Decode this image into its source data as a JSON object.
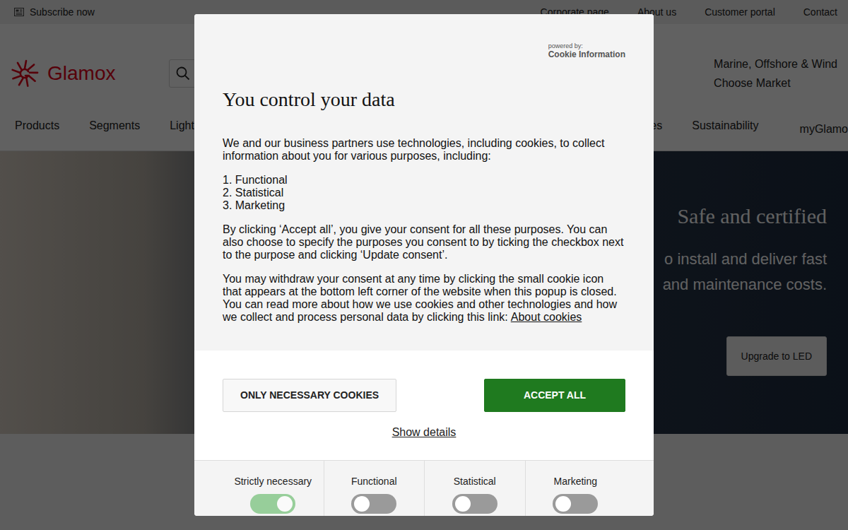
{
  "top_bar": {
    "subscribe": "Subscribe now",
    "links": [
      "Corporate page",
      "About us",
      "Customer portal",
      "Contact"
    ]
  },
  "header": {
    "logo": "Glamox",
    "market": "Marine, Offshore & Wind",
    "choose_market": "Choose Market"
  },
  "nav": {
    "left": [
      "Products",
      "Segments",
      "Light"
    ],
    "right": [
      "es",
      "Sustainability",
      "myGlamo"
    ]
  },
  "hero": {
    "title": "Safe and certified",
    "lines": [
      "o install and deliver fast",
      "and maintenance costs."
    ],
    "button": "Upgrade to LED"
  },
  "cookie_dialog": {
    "powered_by": "powered by:",
    "provider": "Cookie Information",
    "title": "You control your data",
    "intro": "We and our business partners use technologies, including cookies, to collect information about you for various purposes, including:",
    "purposes": [
      "1. Functional",
      "2. Statistical",
      "3. Marketing"
    ],
    "paragraphs": [
      "By clicking ‘Accept all’, you give your consent for all these purposes. You can also choose to specify the purposes you consent to by ticking the checkbox next to the purpose and clicking ‘Update consent’.",
      "You may withdraw your consent at any time by clicking the small cookie icon that appears at the bottom left corner of the website when this popup is closed."
    ],
    "about_text": "You can read more about how we use cookies and other technologies and how we collect and process personal data by clicking this link:",
    "about_link": "About cookies",
    "buttons": {
      "necessary": "ONLY NECESSARY COOKIES",
      "accept": "ACCEPT ALL"
    },
    "show_details": "Show details",
    "categories": [
      {
        "label": "Strictly necessary",
        "on": true,
        "disabled": true
      },
      {
        "label": "Functional",
        "on": false,
        "disabled": false
      },
      {
        "label": "Statistical",
        "on": false,
        "disabled": false
      },
      {
        "label": "Marketing",
        "on": false,
        "disabled": false
      }
    ]
  }
}
